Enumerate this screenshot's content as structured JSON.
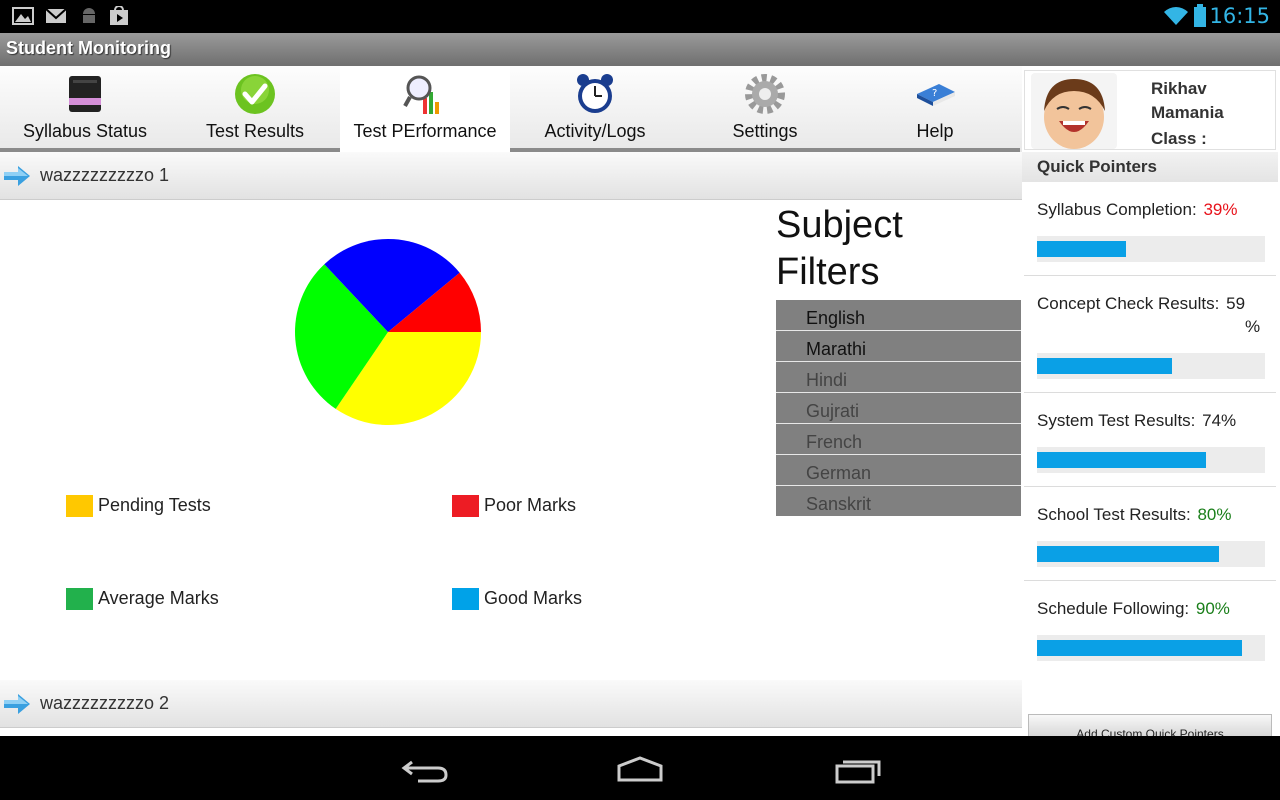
{
  "status_bar": {
    "time": "16:15",
    "icons": [
      "gallery-icon",
      "gmail-icon",
      "android-icon",
      "play-store-icon",
      "wifi-icon",
      "battery-icon"
    ]
  },
  "app": {
    "title": "Student Monitoring"
  },
  "tabs": [
    {
      "label": "Syllabus Status",
      "icon": "notebook-icon"
    },
    {
      "label": "Test Results",
      "icon": "checkmark-icon"
    },
    {
      "label": "Test PErformance",
      "icon": "magnifier-chart-icon",
      "active": true
    },
    {
      "label": "Activity/Logs",
      "icon": "alarm-clock-icon"
    },
    {
      "label": "Settings",
      "icon": "gear-icon"
    },
    {
      "label": "Help",
      "icon": "help-book-icon"
    }
  ],
  "student": {
    "first_name": "Rikhav",
    "last_name": "Mamania",
    "class_label": "Class :"
  },
  "sections": [
    {
      "title": "wazzzzzzzzzo 1"
    },
    {
      "title": "wazzzzzzzzzo 2"
    }
  ],
  "pie_chart": {
    "slices": [
      {
        "color": "#ffff00",
        "fraction": 0.345
      },
      {
        "color": "#00ff00",
        "fraction": 0.285
      },
      {
        "color": "#0000ff",
        "fraction": 0.26
      },
      {
        "color": "#ff0000",
        "fraction": 0.11
      }
    ]
  },
  "legend": [
    {
      "label": "Pending Tests",
      "color": "#ffc800"
    },
    {
      "label": "Poor Marks",
      "color": "#ed1c24"
    },
    {
      "label": "Average Marks",
      "color": "#22b14c"
    },
    {
      "label": "Good Marks",
      "color": "#00a2e8"
    }
  ],
  "filters": {
    "title_line1": "Subject",
    "title_line2": "Filters",
    "items": [
      "English",
      "Marathi",
      "Hindi",
      "Gujrati",
      "French",
      "German",
      "Sanskrit"
    ]
  },
  "quick_pointers": {
    "title": "Quick Pointers",
    "items": [
      {
        "label": "Syllabus Completion:",
        "value": "39%",
        "progress": 0.39,
        "color": "#e8121b"
      },
      {
        "label": "Concept Check Results:",
        "value": "59",
        "value_line2": "%",
        "progress": 0.59,
        "color": "#222222"
      },
      {
        "label": "System Test Results:",
        "value": "74%",
        "progress": 0.74,
        "color": "#222222"
      },
      {
        "label": "School Test Results:",
        "value": "80%",
        "progress": 0.8,
        "color": "#1a7f1a"
      },
      {
        "label": "Schedule Following:",
        "value": "90%",
        "progress": 0.9,
        "color": "#1a7f1a"
      }
    ],
    "add_button": "Add Custom Quick Pointers"
  }
}
